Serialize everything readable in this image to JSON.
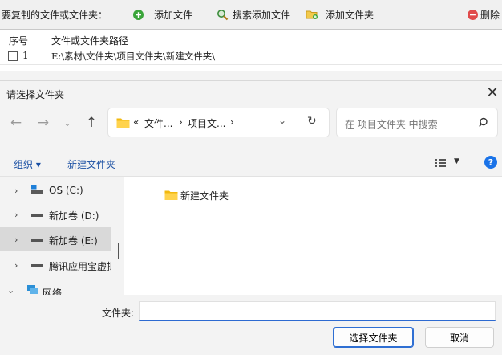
{
  "app": {
    "toolbar": {
      "label": "要复制的文件或文件夹：",
      "add_file": "添加文件",
      "search_add_file": "搜索添加文件",
      "add_folder": "添加文件夹",
      "delete": "删除"
    },
    "list": {
      "columns": [
        "序号",
        "文件或文件夹路径"
      ],
      "rows": [
        {
          "index": "1",
          "path": "E:\\素材\\文件夹\\项目文件夹\\新建文件夹\\"
        }
      ]
    }
  },
  "dialog": {
    "title": "请选择文件夹",
    "address": {
      "overflow": "«",
      "part1": "文件...",
      "part2": "项目文...",
      "separator": "›"
    },
    "search": {
      "placeholder": "在 项目文件夹 中搜索"
    },
    "commands": {
      "organize": "组织 ▾",
      "new_folder": "新建文件夹"
    },
    "nav_tree": [
      {
        "label": "OS (C:)",
        "icon": "os-drive-icon"
      },
      {
        "label": "新加卷 (D:)",
        "icon": "drive-icon"
      },
      {
        "label": "新加卷 (E:)",
        "icon": "drive-icon",
        "selected": true
      },
      {
        "label": "腾讯应用宝虚拟",
        "icon": "drive-icon"
      },
      {
        "label": "网络",
        "icon": "network-icon"
      }
    ],
    "content": {
      "items": [
        {
          "name": "新建文件夹",
          "icon": "folder-icon"
        }
      ]
    },
    "footer": {
      "folder_label": "文件夹:",
      "folder_value": "",
      "select_button": "选择文件夹",
      "cancel_button": "取消"
    },
    "colors": {
      "accent": "#2f6fd3",
      "link": "#1a4fa3",
      "folder": "#f2b90f",
      "help": "#1a73e8"
    }
  }
}
